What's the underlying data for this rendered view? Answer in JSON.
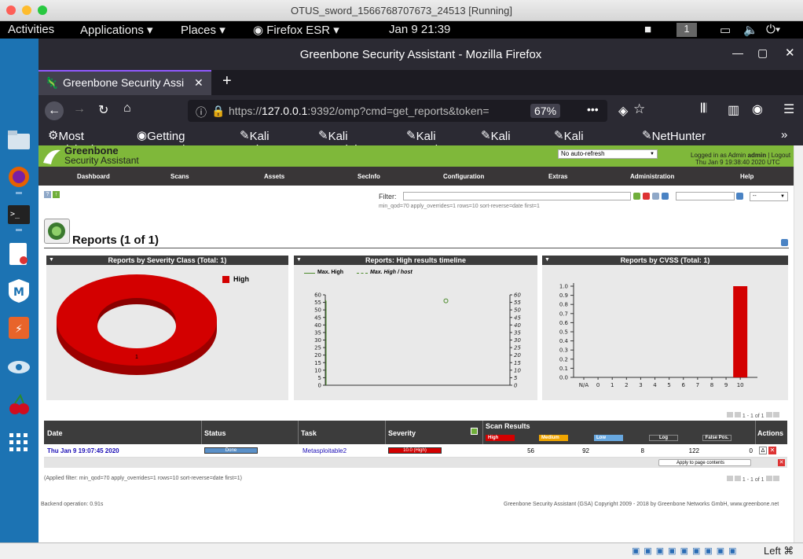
{
  "host": {
    "window_title": "OTUS_sword_1566768707673_24513 [Running]"
  },
  "gnome": {
    "activities": "Activities",
    "applications": "Applications",
    "places": "Places",
    "firefox_menu": "Firefox ESR",
    "clock": "Jan 9  21:39",
    "workspace": "1"
  },
  "firefox": {
    "window_title": "Greenbone Security Assistant - Mozilla Firefox",
    "tab_title": "Greenbone Security Assi",
    "url_prefix": "https://",
    "url_host": "127.0.0.1",
    "url_rest": ":9392/omp?cmd=get_reports&token=",
    "zoom": "67%",
    "bookmarks": [
      "Most Visited",
      "Getting Started",
      "Kali Linux",
      "Kali Training",
      "Kali Tools",
      "Kali Docs",
      "Kali Forums",
      "NetHunter"
    ]
  },
  "gsa": {
    "logo_line1": "Greenbone",
    "logo_line2": "Security Assistant",
    "refresh": "No auto-refresh",
    "logged_in_label": "Logged in as  Admin",
    "user": "admin",
    "logout": "Logout",
    "datetime": "Thu Jan 9 19:38:40 2020 UTC",
    "menu": [
      "Dashboard",
      "Scans",
      "Assets",
      "SecInfo",
      "Configuration",
      "Extras",
      "Administration",
      "Help"
    ],
    "filter_label": "Filter:",
    "filter_text": "min_qod=70 apply_overrides=1 rows=10 sort-reverse=date first=1",
    "filter_select": "--",
    "heading": "Reports (1 of 1)",
    "panels": {
      "severity_title": "Reports by Severity Class (Total: 1)",
      "severity_legend": "High",
      "severity_value": "1",
      "timeline_title": "Reports: High results timeline",
      "timeline_legend1": "Max. High",
      "timeline_legend2": "Max. High / host",
      "cvss_title": "Reports by CVSS (Total: 1)"
    },
    "pager": "1 - 1 of 1",
    "table": {
      "headers": {
        "date": "Date",
        "status": "Status",
        "task": "Task",
        "severity": "Severity",
        "scan_results": "Scan Results",
        "actions": "Actions"
      },
      "sub_headers": {
        "high": "High",
        "medium": "Medium",
        "low": "Low",
        "log": "Log",
        "false_pos": "False Pos."
      },
      "row": {
        "date": "Thu Jan 9 19:07:45 2020",
        "status": "Done",
        "task": "Metasploitable2",
        "severity": "10.0 (High)",
        "high": "56",
        "medium": "92",
        "low": "8",
        "log": "122",
        "false_pos": "0"
      },
      "apply_select": "Apply to page contents"
    },
    "applied_filter": "(Applied filter: min_qod=70 apply_overrides=1 rows=10 sort-reverse=date first=1)",
    "backend": "Backend operation: 0.91s",
    "copyright": "Greenbone Security Assistant (GSA) Copyright 2009 - 2018 by Greenbone Networks GmbH, www.greenbone.net"
  },
  "vm_status": {
    "host_key": "Left ⌘"
  },
  "chart_data": [
    {
      "type": "pie",
      "title": "Reports by Severity Class (Total: 1)",
      "categories": [
        "High"
      ],
      "values": [
        1
      ],
      "colors": [
        "#d30000"
      ]
    },
    {
      "type": "line",
      "title": "Reports: High results timeline",
      "series": [
        {
          "name": "Max. High",
          "values": [
            56
          ]
        },
        {
          "name": "Max. High / host",
          "values": [
            56
          ]
        }
      ],
      "ylim": [
        0,
        60
      ],
      "yticks": [
        "0",
        "5",
        "10",
        "15",
        "20",
        "25",
        "30",
        "35",
        "40",
        "45",
        "50",
        "55",
        "60"
      ]
    },
    {
      "type": "bar",
      "title": "Reports by CVSS (Total: 1)",
      "categories": [
        "N/A",
        "0",
        "1",
        "2",
        "3",
        "4",
        "5",
        "6",
        "7",
        "8",
        "9",
        "10"
      ],
      "values": [
        0,
        0,
        0,
        0,
        0,
        0,
        0,
        0,
        0,
        0,
        0,
        1
      ],
      "ylim": [
        0,
        1.0
      ],
      "yticks": [
        "0.0",
        "0.1",
        "0.2",
        "0.3",
        "0.4",
        "0.5",
        "0.6",
        "0.7",
        "0.8",
        "0.9",
        "1.0"
      ],
      "color": "#d30000"
    }
  ]
}
